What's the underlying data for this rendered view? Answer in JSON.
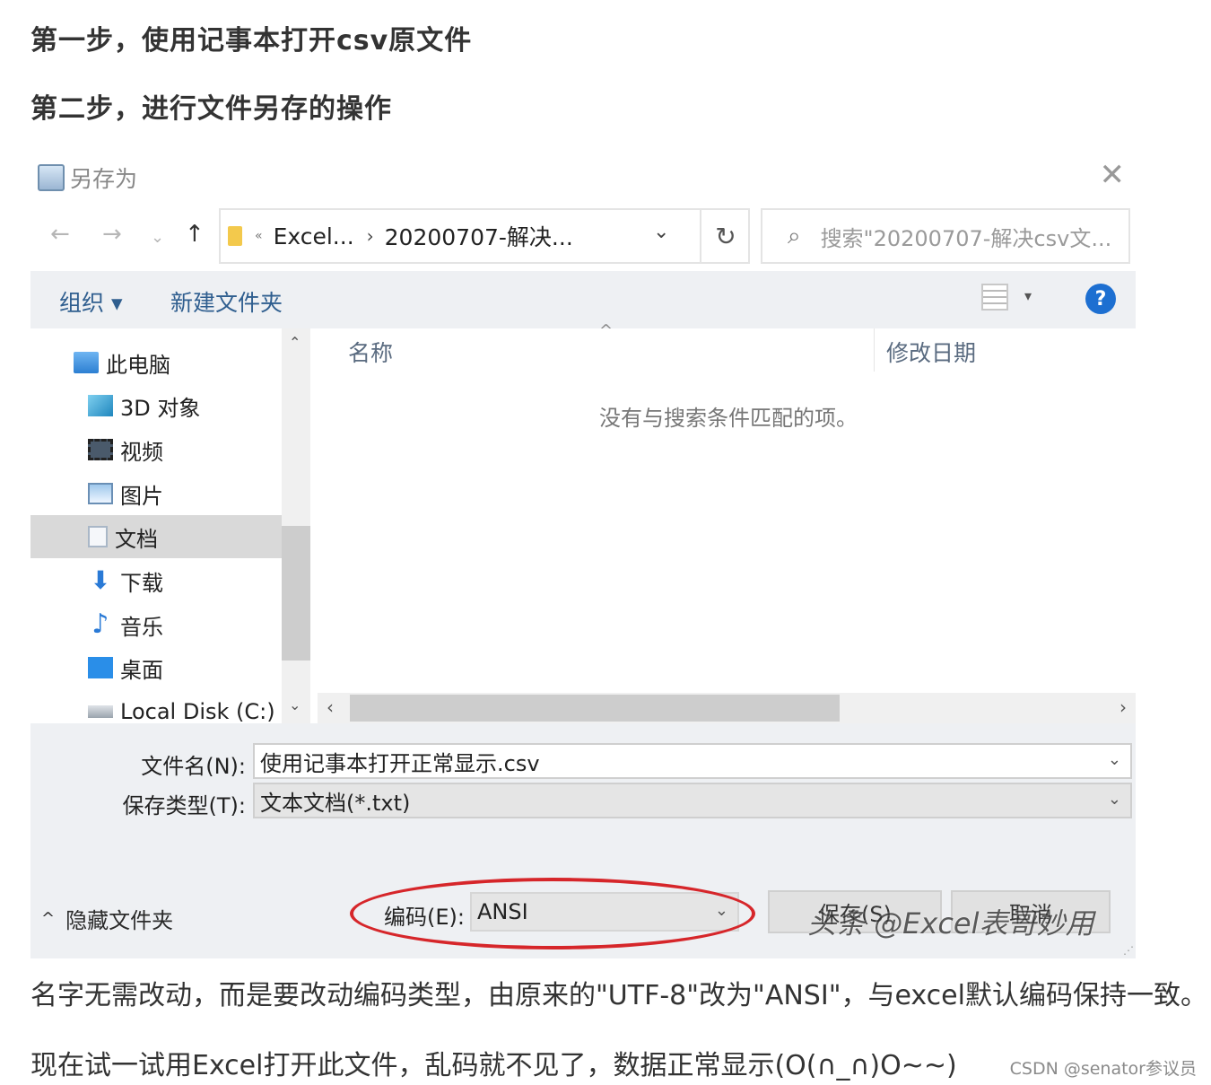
{
  "headings": {
    "step1": "第一步，使用记事本打开csv原文件",
    "step2": "第二步，进行文件另存的操作"
  },
  "dialog": {
    "title": "另存为",
    "path": {
      "crumb1": "Excel...",
      "crumb2": "20200707-解决..."
    },
    "search_placeholder": "搜索\"20200707-解决csv文...",
    "toolbar": {
      "organize": "组织 ▾",
      "new_folder": "新建文件夹"
    },
    "nav_items": [
      {
        "label": "此电脑",
        "icon": "computer-icon"
      },
      {
        "label": "3D 对象",
        "icon": "cube-icon"
      },
      {
        "label": "视频",
        "icon": "video-icon"
      },
      {
        "label": "图片",
        "icon": "picture-icon"
      },
      {
        "label": "文档",
        "icon": "document-icon"
      },
      {
        "label": "下载",
        "icon": "download-icon"
      },
      {
        "label": "音乐",
        "icon": "music-icon"
      },
      {
        "label": "桌面",
        "icon": "desktop-icon"
      },
      {
        "label": "Local Disk (C:)",
        "icon": "disk-icon"
      }
    ],
    "columns": {
      "name": "名称",
      "date": "修改日期"
    },
    "empty_message": "没有与搜索条件匹配的项。",
    "fields": {
      "filename_label": "文件名(N):",
      "filename_value": "使用记事本打开正常显示.csv",
      "savetype_label": "保存类型(T):",
      "savetype_value": "文本文档(*.txt)"
    },
    "hide_folders": "隐藏文件夹",
    "encoding": {
      "label": "编码(E):",
      "value": "ANSI"
    },
    "buttons": {
      "save": "保存(S)",
      "cancel": "取消"
    },
    "overlay": "头条 @Excel表哥妙用",
    "highlight_color": "#d6262a"
  },
  "paragraphs": {
    "p1": "名字无需改动，而是要改动编码类型，由原来的\"UTF-8\"改为\"ANSI\"，与excel默认编码保持一致。",
    "p2": "现在试一试用Excel打开此文件，乱码就不见了，数据正常显示(O(∩_∩)O~~)"
  },
  "watermark": "CSDN @senator参议员"
}
